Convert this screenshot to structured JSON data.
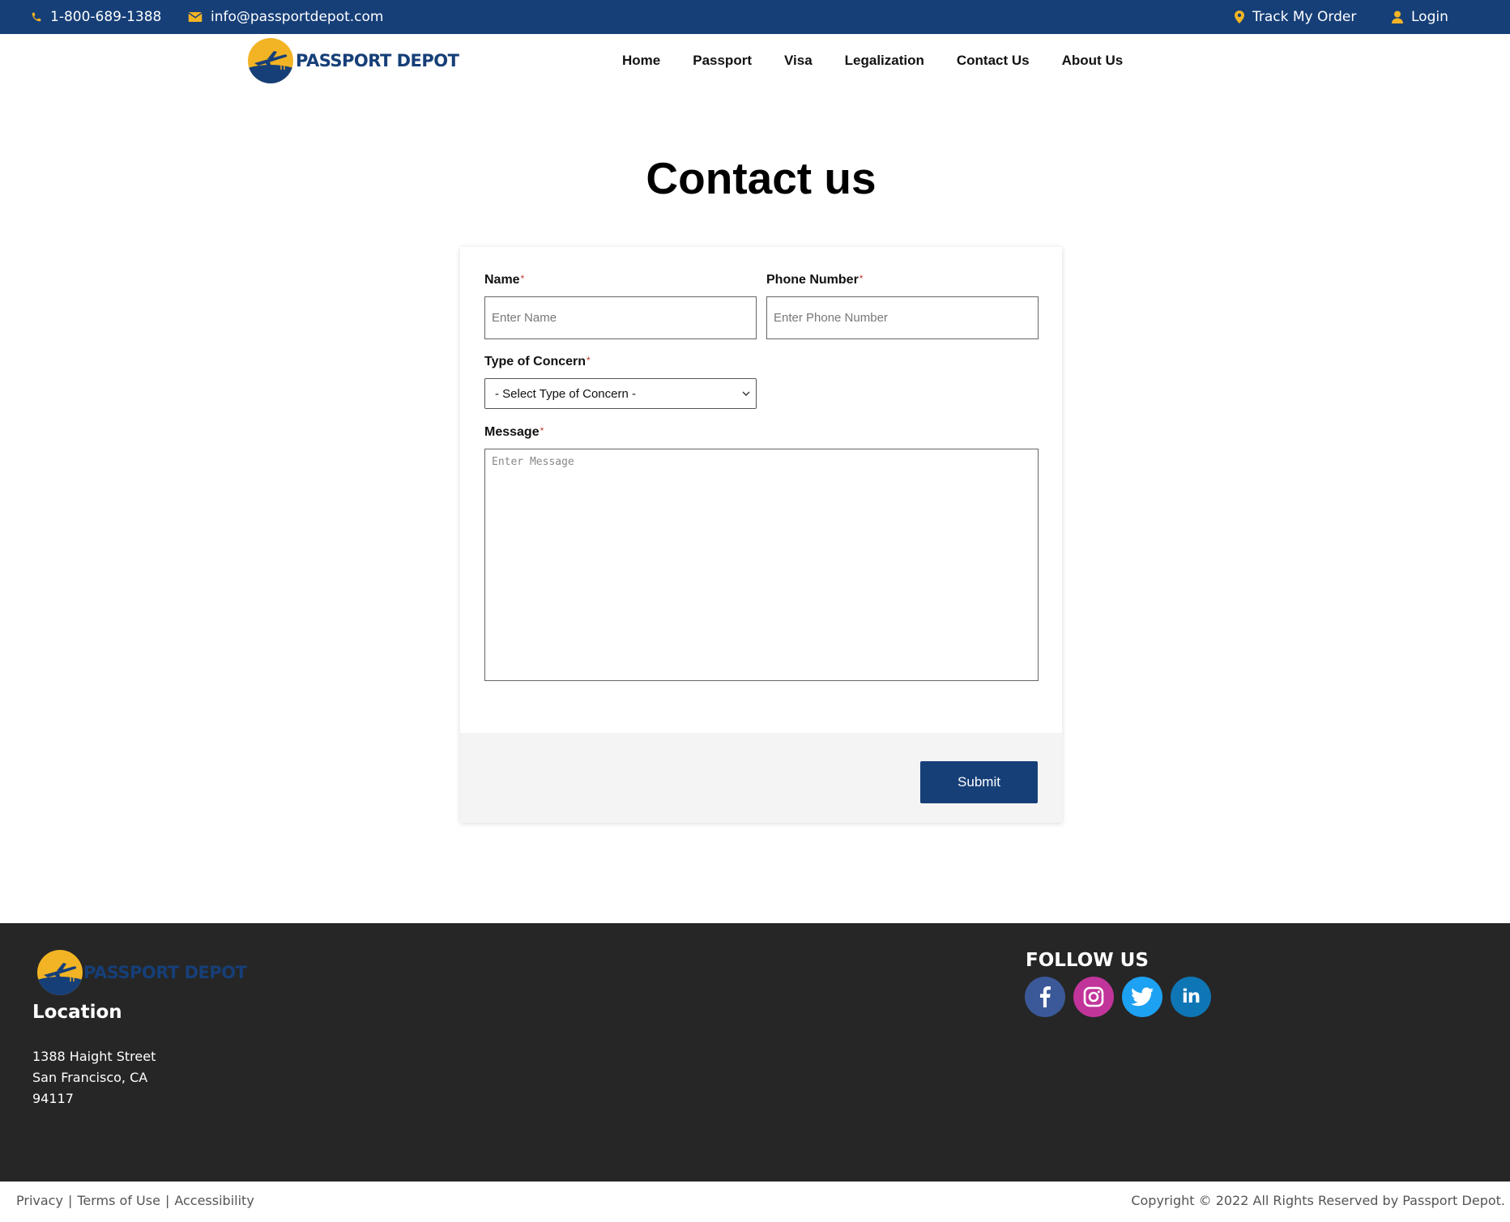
{
  "topbar": {
    "phone": "1-800-689-1388",
    "email": "info@passportdepot.com",
    "track_order": "Track My Order",
    "login": "Login"
  },
  "brand": {
    "name": "PASSPORT DEPOT",
    "colors": {
      "primary": "#163f78",
      "accent": "#f2b424",
      "footer_bg": "#262626"
    }
  },
  "nav": [
    "Home",
    "Passport",
    "Visa",
    "Legalization",
    "Contact Us",
    "About Us"
  ],
  "page": {
    "title": "Contact us"
  },
  "form": {
    "name": {
      "label": "Name",
      "required_mark": "*",
      "placeholder": "Enter Name",
      "value": ""
    },
    "phone": {
      "label": "Phone Number",
      "required_mark": "*",
      "placeholder": "Enter Phone Number",
      "value": ""
    },
    "concern": {
      "label": "Type of Concern",
      "required_mark": "*",
      "selected": "- Select Type of Concern -"
    },
    "message": {
      "label": "Message",
      "required_mark": "*",
      "placeholder": "Enter Message",
      "value": ""
    },
    "submit_label": "Submit"
  },
  "footer": {
    "location_heading": "Location",
    "address": [
      "1388 Haight Street",
      "San Francisco, CA",
      "94117"
    ],
    "follow_heading": "FOLLOW US",
    "social": [
      {
        "name": "facebook",
        "icon": "facebook-icon",
        "color": "#3b5998"
      },
      {
        "name": "instagram",
        "icon": "instagram-icon",
        "color": "#c1359a"
      },
      {
        "name": "twitter",
        "icon": "twitter-icon",
        "color": "#1da1f2"
      },
      {
        "name": "linkedin",
        "icon": "linkedin-icon",
        "color": "#0e76b5"
      }
    ]
  },
  "legal": {
    "links": [
      "Privacy",
      "Terms of Use",
      "Accessibility"
    ],
    "separator": "|",
    "copyright": "Copyright © 2022 All Rights Reserved by Passport Depot."
  }
}
